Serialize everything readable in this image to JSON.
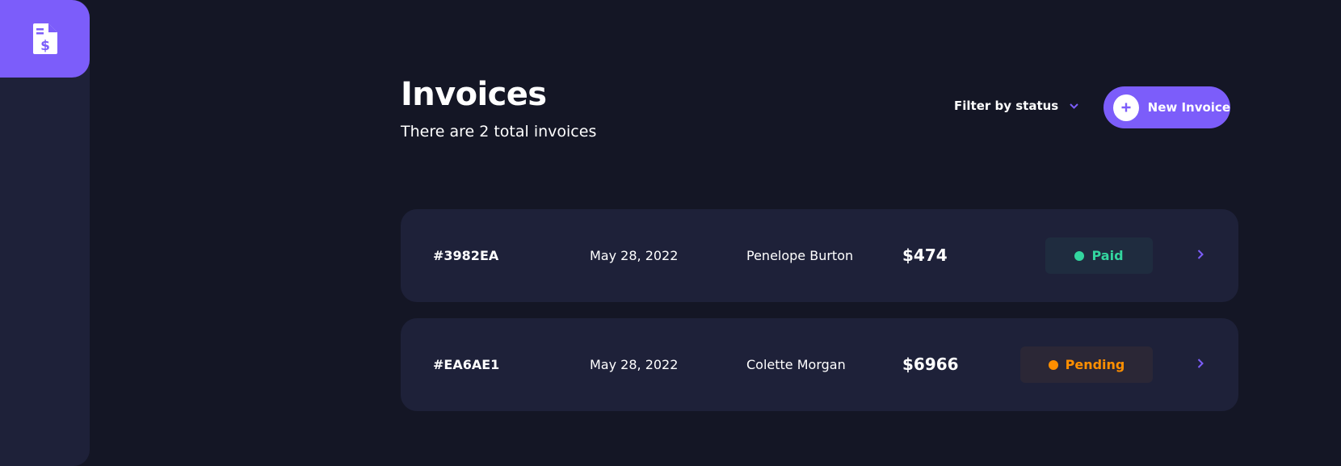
{
  "sidebar": {
    "logo_icon": "invoice-dollar-icon",
    "accent": "#7c5dfa"
  },
  "header": {
    "title": "Invoices",
    "subtitle": "There are 2 total invoices",
    "filter_label": "Filter by status",
    "new_invoice_label": "New Invoice"
  },
  "invoices": [
    {
      "id": "#3982EA",
      "date": "May 28, 2022",
      "client": "Penelope Burton",
      "amount": "$474",
      "status": "Paid",
      "status_color": "#33d69f"
    },
    {
      "id": "#EA6AE1",
      "date": "May 28, 2022",
      "client": "Colette Morgan",
      "amount": "$6966",
      "status": "Pending",
      "status_color": "#ff8f00"
    }
  ]
}
